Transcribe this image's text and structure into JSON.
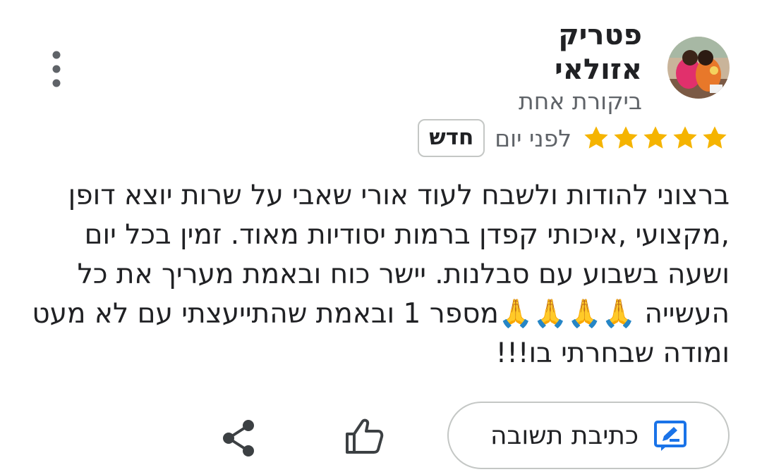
{
  "reviewer": {
    "name": "פטריק אזולאי",
    "review_count": "ביקורת אחת",
    "avatar": "photo-avatar"
  },
  "review": {
    "rating": 5,
    "max_rating": 5,
    "star_color": "#f5b400",
    "date": "לפני יום",
    "badge": "חדש",
    "text": "ברצוני להודות ולשבח לעוד אורי שאבי על שרות יוצא דופן ,מקצועי ,איכותי קפדן ברמות יסודיות מאוד. זמין בכל יום ושעה בשבוע עם סבלנות. יישר כוח ובאמת מעריך את כל העשייה 🙏🙏🙏🙏מספר 1 ובאמת שהתייעצתי עם לא מעט ומודה שבחרתי בו!!!"
  },
  "actions": {
    "reply_label": "כתיבת תשובה",
    "reply_icon": "edit-reply-icon",
    "like_icon": "thumbs-up-icon",
    "share_icon": "share-icon",
    "menu_icon": "more-vert-icon",
    "accent_color": "#1a73e8"
  }
}
